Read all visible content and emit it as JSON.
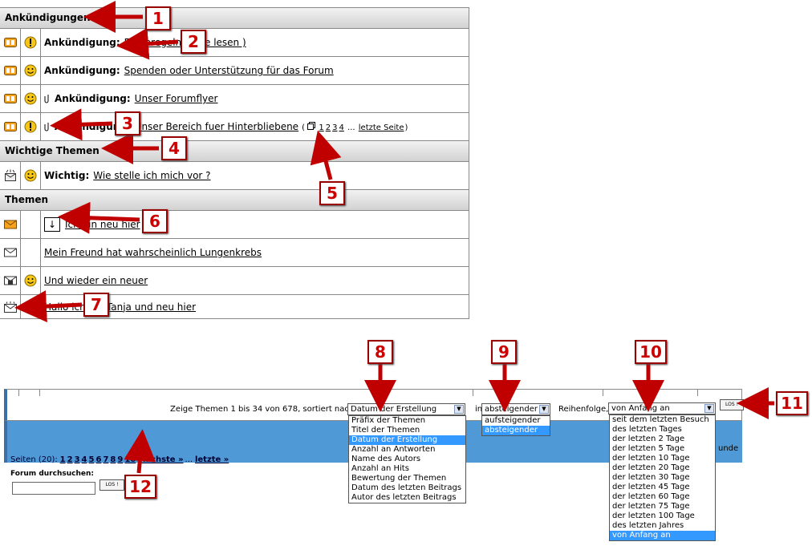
{
  "sections": {
    "announcements": "Ankündigungen",
    "important": "Wichtige Themen",
    "topics": "Themen"
  },
  "announcement_rows": [
    {
      "label": "Ankündigung:",
      "link": "Forenregeln (bitte lesen )"
    },
    {
      "label": "Ankündigung:",
      "link": "Spenden oder Unterstützung für das Forum"
    },
    {
      "label": "Ankündigung:",
      "link": "Unser Forumflyer"
    },
    {
      "label": "Ankündigung:",
      "link": "Unser Bereich fuer Hinterbliebene",
      "pages": [
        "1",
        "2",
        "3",
        "4"
      ],
      "ellipsis": "...",
      "last": "letzte Seite"
    }
  ],
  "important_rows": [
    {
      "label": "Wichtig:",
      "link": "Wie stelle ich mich vor ?"
    }
  ],
  "topic_rows": [
    {
      "link": "Ich bin neu hier"
    },
    {
      "link": "Mein Freund hat wahrscheinlich Lungenkrebs"
    },
    {
      "link": "Und wieder ein neuer"
    },
    {
      "link": "Hallo ich bin Tanja und neu hier"
    }
  ],
  "sortbar": {
    "prefix": "Zeige Themen 1 bis 34 von 678, sortiert nach",
    "in": "in",
    "order_label": "Reihenfolge,",
    "sort_value": "Datum der Erstellung",
    "order_value": "absteigender",
    "range_value": "von Anfang an",
    "go": "LOS !",
    "sort_options": [
      "Präfix der Themen",
      "Titel der Themen",
      "Datum der Erstellung",
      "Anzahl an Antworten",
      "Name des Autors",
      "Anzahl an Hits",
      "Bewertung der Themen",
      "Datum des letzten Beitrags",
      "Autor des letzten Beitrags"
    ],
    "order_options": [
      "aufsteigender",
      "absteigender"
    ],
    "range_options": [
      "seit dem letzten Besuch",
      "des letzten Tages",
      "der letzten 2 Tage",
      "der letzten 5 Tage",
      "der letzten 10 Tage",
      "der letzten 20 Tage",
      "der letzten 30 Tage",
      "der letzten 45 Tage",
      "der letzten 60 Tage",
      "der letzten 75 Tage",
      "der letzten 100 Tage",
      "des letzten Jahres",
      "von Anfang an"
    ],
    "hidden_tail": "unde"
  },
  "pagination": {
    "prefix": "Seiten (20):",
    "pages": [
      "1",
      "2",
      "3",
      "4",
      "5",
      "6",
      "7",
      "8",
      "9",
      "10"
    ],
    "next": "nächste »",
    "ellipsis": "...",
    "last": "letzte »"
  },
  "forum_search": {
    "label": "Forum durchsuchen:",
    "go": "LOS !"
  },
  "callouts": [
    "1",
    "2",
    "3",
    "4",
    "5",
    "6",
    "7",
    "8",
    "9",
    "10",
    "11",
    "12"
  ],
  "colors": {
    "callout": "#c00000",
    "header_band": "#4f9ad6",
    "highlight": "#3399ff"
  }
}
